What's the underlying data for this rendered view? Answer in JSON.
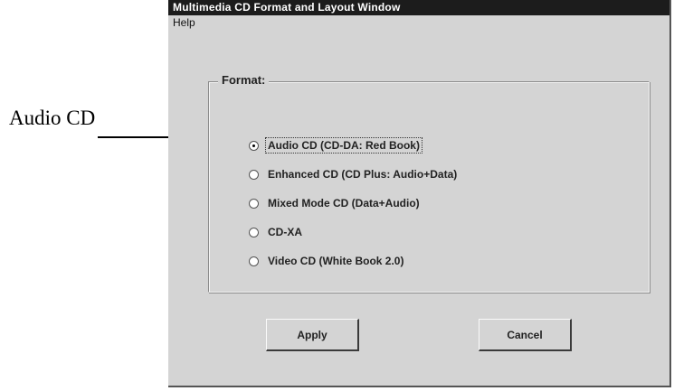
{
  "annotation": {
    "label": "Audio CD"
  },
  "window": {
    "title": "Multimedia CD Format and Layout Window",
    "menu": [
      "Help"
    ]
  },
  "format_group": {
    "legend": "Format:",
    "options": [
      {
        "label": "Audio CD (CD-DA: Red Book)",
        "checked": true
      },
      {
        "label": "Enhanced CD (CD Plus: Audio+Data)",
        "checked": false
      },
      {
        "label": "Mixed Mode CD (Data+Audio)",
        "checked": false
      },
      {
        "label": "CD-XA",
        "checked": false
      },
      {
        "label": "Video CD (White Book 2.0)",
        "checked": false
      }
    ]
  },
  "buttons": {
    "apply": "Apply",
    "cancel": "Cancel"
  }
}
